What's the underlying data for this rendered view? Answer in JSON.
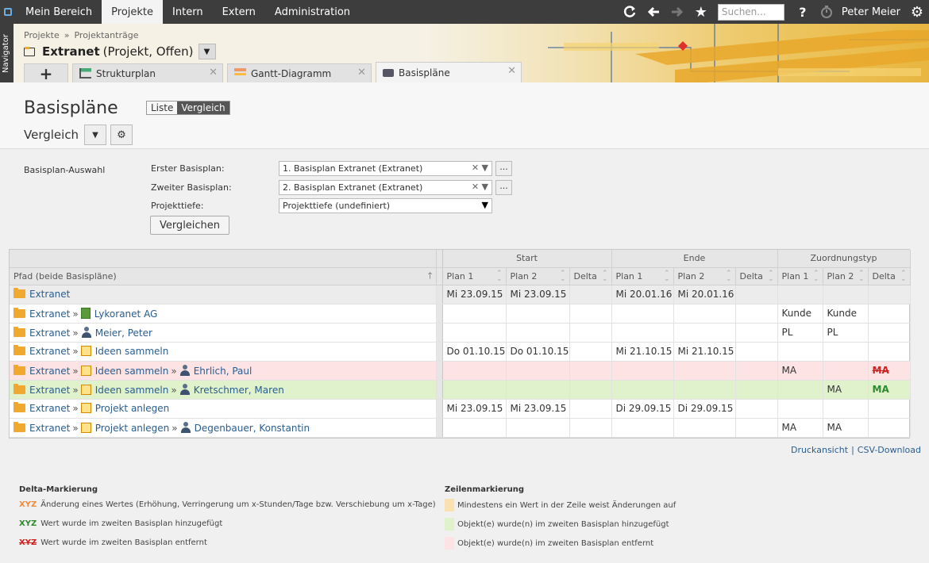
{
  "topnav": {
    "tabs": [
      "Mein Bereich",
      "Projekte",
      "Intern",
      "Extern",
      "Administration"
    ],
    "search_placeholder": "Suchen...",
    "help": "?",
    "user": "Peter Meier"
  },
  "navigator": "Navigator",
  "breadcrumb": [
    "Projekte",
    "Projektanträge"
  ],
  "project": {
    "name": "Extranet",
    "suffix": "(Projekt, Offen)"
  },
  "tabs": [
    {
      "label": "+"
    },
    {
      "label": "Strukturplan"
    },
    {
      "label": "Gantt-Diagramm"
    },
    {
      "label": "Basispläne"
    }
  ],
  "page": {
    "title": "Basispläne",
    "toggle": [
      "Liste",
      "Vergleich"
    ],
    "subtitle": "Vergleich"
  },
  "form": {
    "section_label": "Basisplan-Auswahl",
    "first_label": "Erster Basisplan:",
    "first_value": "1. Basisplan Extranet (Extranet)",
    "second_label": "Zweiter Basisplan:",
    "second_value": "2. Basisplan Extranet (Extranet)",
    "depth_label": "Projekttiefe:",
    "depth_value": "Projekttiefe (undefiniert)",
    "compare_button": "Vergleichen",
    "dots": "..."
  },
  "table": {
    "groups": [
      "Start",
      "Ende",
      "Zuordnungstyp"
    ],
    "path_header": "Pfad (beide Basispläne)",
    "cols": [
      "Plan 1",
      "Plan 2",
      "Delta",
      "Plan 1",
      "Plan 2",
      "Delta",
      "Plan 1",
      "Plan 2",
      "Delta"
    ],
    "rows": [
      {
        "style": "grey",
        "path": [
          {
            "icon": "folder",
            "text": "Extranet"
          }
        ],
        "cells": [
          "Mi 23.09.15",
          "Mi 23.09.15",
          "",
          "Mi 20.01.16",
          "Mi 20.01.16",
          "",
          "",
          "",
          ""
        ]
      },
      {
        "style": "",
        "path": [
          {
            "icon": "folder",
            "text": "Extranet"
          },
          {
            "icon": "org",
            "text": "Lykoranet AG"
          }
        ],
        "cells": [
          "",
          "",
          "",
          "",
          "",
          "",
          "Kunde",
          "Kunde",
          ""
        ]
      },
      {
        "style": "",
        "path": [
          {
            "icon": "folder",
            "text": "Extranet"
          },
          {
            "icon": "person",
            "text": "Meier, Peter"
          }
        ],
        "cells": [
          "",
          "",
          "",
          "",
          "",
          "",
          "PL",
          "PL",
          ""
        ]
      },
      {
        "style": "",
        "path": [
          {
            "icon": "folder",
            "text": "Extranet"
          },
          {
            "icon": "task",
            "text": "Ideen sammeln"
          }
        ],
        "cells": [
          "Do 01.10.15",
          "Do 01.10.15",
          "",
          "Mi 21.10.15",
          "Mi 21.10.15",
          "",
          "",
          "",
          ""
        ]
      },
      {
        "style": "red",
        "path": [
          {
            "icon": "folder",
            "text": "Extranet"
          },
          {
            "icon": "task",
            "text": "Ideen sammeln"
          },
          {
            "icon": "person",
            "text": "Ehrlich, Paul"
          }
        ],
        "cells": [
          "",
          "",
          "",
          "",
          "",
          "",
          "MA",
          "",
          "MA"
        ],
        "delta_kind": "del"
      },
      {
        "style": "green",
        "path": [
          {
            "icon": "folder",
            "text": "Extranet"
          },
          {
            "icon": "task",
            "text": "Ideen sammeln"
          },
          {
            "icon": "person",
            "text": "Kretschmer, Maren"
          }
        ],
        "cells": [
          "",
          "",
          "",
          "",
          "",
          "",
          "",
          "MA",
          "MA"
        ],
        "delta_kind": "add"
      },
      {
        "style": "",
        "path": [
          {
            "icon": "folder",
            "text": "Extranet"
          },
          {
            "icon": "task",
            "text": "Projekt anlegen"
          }
        ],
        "cells": [
          "Mi 23.09.15",
          "Mi 23.09.15",
          "",
          "Di 29.09.15",
          "Di 29.09.15",
          "",
          "",
          "",
          ""
        ]
      },
      {
        "style": "",
        "path": [
          {
            "icon": "folder",
            "text": "Extranet"
          },
          {
            "icon": "task",
            "text": "Projekt anlegen"
          },
          {
            "icon": "person",
            "text": "Degenbauer, Konstantin"
          }
        ],
        "cells": [
          "",
          "",
          "",
          "",
          "",
          "",
          "MA",
          "MA",
          ""
        ]
      }
    ]
  },
  "links": {
    "print": "Druckansicht",
    "csv": "CSV-Download"
  },
  "legend": {
    "delta_title": "Delta-Markierung",
    "delta_items": [
      {
        "mark": "XYZ",
        "kind": "change",
        "color": "#f08a3c",
        "text": "Änderung eines Wertes (Erhöhung, Verringerung um x-Stunden/Tage bzw. Verschiebung um x-Tage)"
      },
      {
        "mark": "XYZ",
        "kind": "add",
        "color": "#2e8a2e",
        "text": "Wert wurde im zweiten Basisplan hinzugefügt"
      },
      {
        "mark": "XYZ",
        "kind": "del",
        "color": "#cc2222",
        "text": "Wert wurde im zweiten Basisplan entfernt"
      }
    ],
    "row_title": "Zeilenmarkierung",
    "row_items": [
      {
        "color": "#fbe0b0",
        "text": "Mindestens ein Wert in der Zeile weist Änderungen auf"
      },
      {
        "color": "#dff2cc",
        "text": "Objekt(e) wurde(n) im zweiten Basisplan hinzugefügt"
      },
      {
        "color": "#fde3e3",
        "text": "Objekt(e) wurde(n) im zweiten Basisplan entfernt"
      }
    ]
  }
}
